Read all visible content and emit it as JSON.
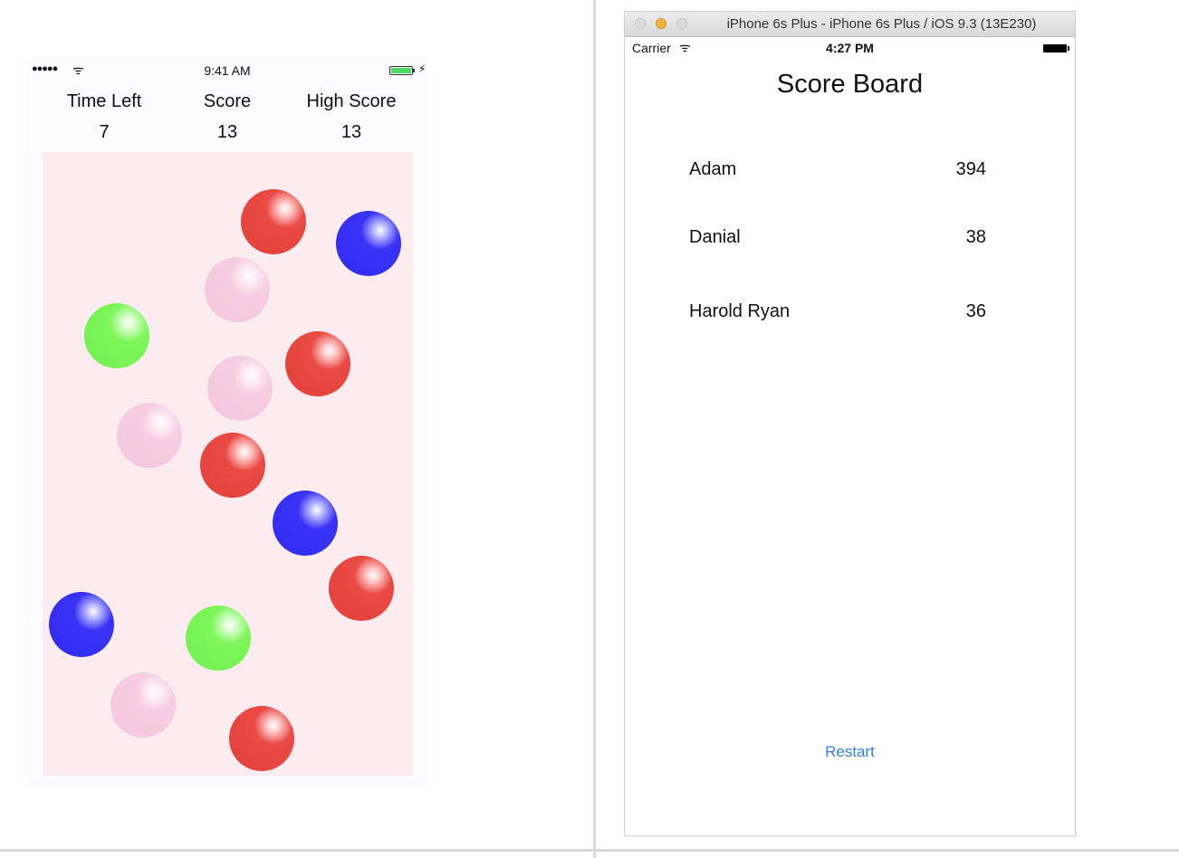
{
  "game": {
    "status_bar": {
      "signal": "●●●●●",
      "wifi": "ᯤ",
      "time": "9:41 AM",
      "charging": "⚡",
      "battery_color": "#4cd964"
    },
    "hud": {
      "time_left": {
        "label": "Time Left",
        "value": "7"
      },
      "score": {
        "label": "Score",
        "value": "13"
      },
      "high_score": {
        "label": "High Score",
        "value": "13"
      }
    },
    "playfield_color": "#fbecef",
    "balls": [
      {
        "color": "red"
      },
      {
        "color": "blue"
      },
      {
        "color": "pink"
      },
      {
        "color": "green"
      },
      {
        "color": "red"
      },
      {
        "color": "pink"
      },
      {
        "color": "pink"
      },
      {
        "color": "red"
      },
      {
        "color": "blue"
      },
      {
        "color": "red"
      },
      {
        "color": "blue"
      },
      {
        "color": "green"
      },
      {
        "color": "pink"
      },
      {
        "color": "red"
      }
    ]
  },
  "simulator": {
    "window_title": "iPhone 6s Plus - iPhone 6s Plus / iOS 9.3 (13E230)",
    "status_bar": {
      "carrier": "Carrier",
      "wifi": "ᯤ",
      "time": "4:27 PM"
    },
    "title": "Score Board",
    "scores": [
      {
        "name": "Adam",
        "score": "394"
      },
      {
        "name": "Danial",
        "score": "38"
      },
      {
        "name": "Harold Ryan",
        "score": "36"
      }
    ],
    "restart_label": "Restart",
    "accent_color": "#2f7fe0"
  }
}
